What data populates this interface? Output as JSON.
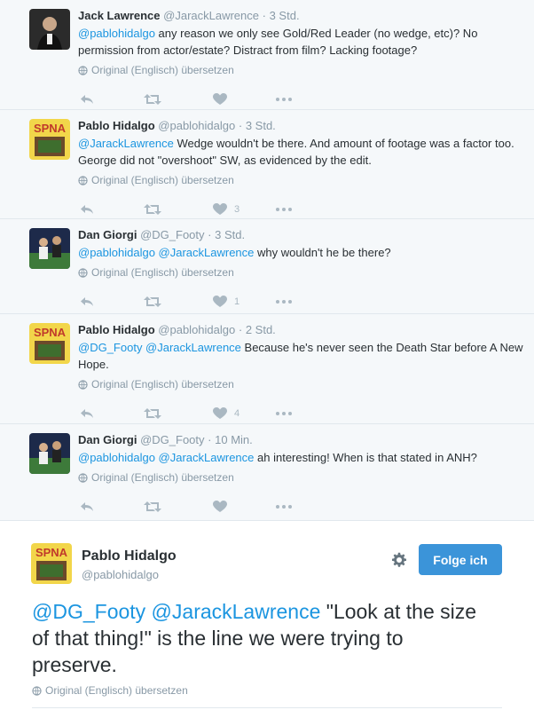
{
  "tweets": [
    {
      "name": "Jack Lawrence",
      "handle": "@JarackLawrence",
      "time": "3 Std.",
      "mentions": "@pablohidalgo",
      "text": " any reason we only see Gold/Red Leader (no wedge, etc)? No permission from actor/estate? Distract from  film? Lacking footage?",
      "translate": "Original (Englisch) übersetzen",
      "likes": ""
    },
    {
      "name": "Pablo Hidalgo",
      "handle": "@pablohidalgo",
      "time": "3 Std.",
      "mentions": "@JarackLawrence",
      "text": " Wedge wouldn't be there. And amount of footage was a factor too. George did not \"overshoot\" SW, as evidenced by the edit.",
      "translate": "Original (Englisch) übersetzen",
      "likes": "3"
    },
    {
      "name": "Dan Giorgi",
      "handle": "@DG_Footy",
      "time": "3 Std.",
      "mentions": "@pablohidalgo @JarackLawrence",
      "text": " why wouldn't he be there?",
      "translate": "Original (Englisch) übersetzen",
      "likes": "1"
    },
    {
      "name": "Pablo Hidalgo",
      "handle": "@pablohidalgo",
      "time": "2 Std.",
      "mentions": "@DG_Footy @JarackLawrence",
      "text": " Because he's never seen the Death Star before A New Hope.",
      "translate": "Original (Englisch) übersetzen",
      "likes": "4"
    },
    {
      "name": "Dan Giorgi",
      "handle": "@DG_Footy",
      "time": "10 Min.",
      "mentions": "@pablohidalgo @JarackLawrence",
      "text": " ah interesting! When is that stated in ANH?",
      "translate": "Original (Englisch) übersetzen",
      "likes": ""
    }
  ],
  "main": {
    "name": "Pablo Hidalgo",
    "handle": "@pablohidalgo",
    "follow_label": "Folge ich",
    "mentions": "@DG_Footy @JarackLawrence",
    "text": " \"Look at the size of that thing!\" is the line we were trying to preserve.",
    "translate": "Original (Englisch) übersetzen"
  },
  "colors": {
    "link": "#1b95e0",
    "follow_button": "#3b94d9",
    "muted": "#8899a6",
    "icon": "#aab8c2"
  },
  "icons": [
    "globe-icon",
    "reply-icon",
    "retweet-icon",
    "heart-icon",
    "more-icon",
    "gear-icon"
  ]
}
